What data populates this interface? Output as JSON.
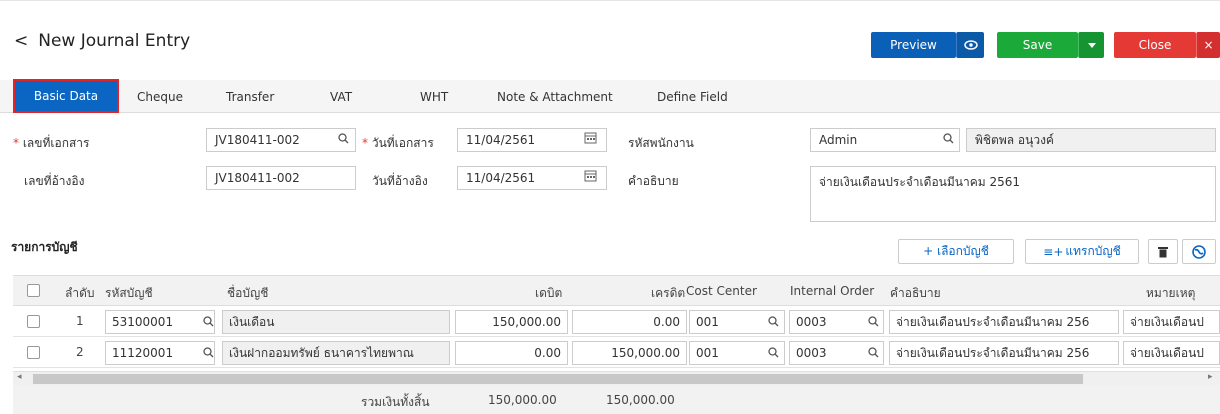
{
  "header": {
    "back_icon": "chevron-left-icon",
    "title": "New Journal Entry",
    "buttons": {
      "preview": "Preview",
      "save": "Save",
      "close": "Close",
      "close_x": "×"
    }
  },
  "tabs": [
    {
      "label": "Basic Data",
      "active": true
    },
    {
      "label": "Cheque"
    },
    {
      "label": "Transfer"
    },
    {
      "label": "VAT"
    },
    {
      "label": "WHT"
    },
    {
      "label": "Note & Attachment"
    },
    {
      "label": "Define Field"
    }
  ],
  "form": {
    "doc_no_label": "เลขที่เอกสาร",
    "doc_no_value": "JV180411-002",
    "doc_date_label": "วันที่เอกสาร",
    "doc_date_value": "11/04/2561",
    "employee_label": "รหัสพนักงาน",
    "employee_code": "Admin",
    "employee_name": "พิชิตพล อนุวงค์",
    "ref_no_label": "เลขที่อ้างอิง",
    "ref_no_value": "JV180411-002",
    "ref_date_label": "วันที่อ้างอิง",
    "ref_date_value": "11/04/2561",
    "description_label": "คำอธิบาย",
    "description_value": "จ่ายเงินเดือนประจำเดือนมีนาคม 2561"
  },
  "accounts": {
    "section_title": "รายการบัญชี",
    "select_account_label": "+  เลือกบัญชี",
    "insert_account_label": "แทรกบัญชี",
    "columns": {
      "seq": "ลำดับ",
      "code": "รหัสบัญชี",
      "name": "ชื่อบัญชี",
      "debit": "เดบิต",
      "credit": "เครดิต",
      "cost_center": "Cost Center",
      "internal_order": "Internal Order",
      "description": "คำอธิบาย",
      "remark": "หมายเหตุ"
    },
    "rows": [
      {
        "seq": "1",
        "code": "53100001",
        "name": "เงินเดือน",
        "debit": "150,000.00",
        "credit": "0.00",
        "cost_center": "001",
        "internal_order": "0003",
        "description": "จ่ายเงินเดือนประจำเดือนมีนาคม 256",
        "remark": "จ่ายเงินเดือนป"
      },
      {
        "seq": "2",
        "code": "11120001",
        "name": "เงินฝากออมทรัพย์ ธนาคารไทยพาณ",
        "debit": "0.00",
        "credit": "150,000.00",
        "cost_center": "001",
        "internal_order": "0003",
        "description": "จ่ายเงินเดือนประจำเดือนมีนาคม 256",
        "remark": "จ่ายเงินเดือนป"
      }
    ],
    "total_label": "รวมเงินทั้งสิ้น",
    "total_debit": "150,000.00",
    "total_credit": "150,000.00"
  },
  "colors": {
    "primary": "#0a66c2",
    "save": "#1ba93a",
    "close": "#e53935",
    "highlight": "#e32424"
  }
}
